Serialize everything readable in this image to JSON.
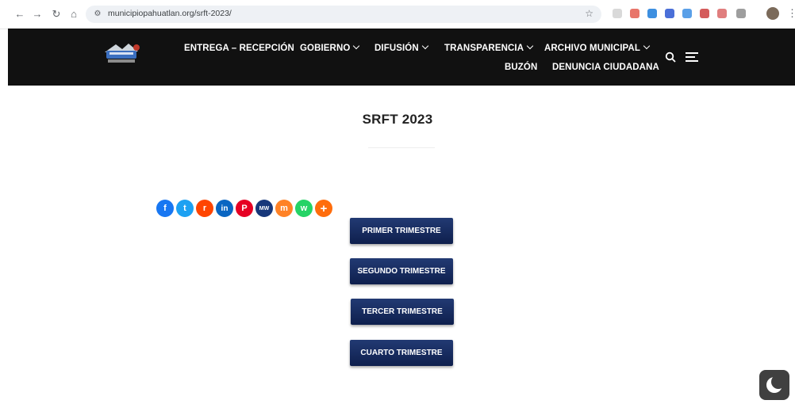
{
  "browser": {
    "url": "municipiopahuatlan.org/srft-2023/",
    "icons": [
      "back-icon",
      "forward-icon",
      "reload-icon",
      "home-icon",
      "site-info-icon",
      "bookmark-star-icon",
      "extensions-icon",
      "profile-avatar",
      "more-menu-icon"
    ]
  },
  "header": {
    "menu": [
      {
        "label": "ENTREGA – RECEPCIÓN",
        "has_submenu": false
      },
      {
        "label": "GOBIERNO",
        "has_submenu": true
      },
      {
        "label": "DIFUSIÓN",
        "has_submenu": true
      },
      {
        "label": "TRANSPARENCIA",
        "has_submenu": true
      },
      {
        "label": "ARCHIVO MUNICIPAL",
        "has_submenu": true
      },
      {
        "label": "BUZÓN",
        "has_submenu": false
      },
      {
        "label": "DENUNCIA CIUDADANA",
        "has_submenu": false
      }
    ]
  },
  "page": {
    "title": "SRFT 2023"
  },
  "share": {
    "icons": [
      {
        "name": "facebook",
        "color": "#1877f2",
        "glyph": "f"
      },
      {
        "name": "twitter",
        "color": "#1da1f2",
        "glyph": "t"
      },
      {
        "name": "reddit",
        "color": "#ff4500",
        "glyph": "r"
      },
      {
        "name": "linkedin",
        "color": "#0a66c2",
        "glyph": "in"
      },
      {
        "name": "pinterest",
        "color": "#e60023",
        "glyph": "P"
      },
      {
        "name": "mewe",
        "color": "#17377a",
        "glyph": "MW"
      },
      {
        "name": "mix",
        "color": "#ff8226",
        "glyph": "m"
      },
      {
        "name": "whatsapp",
        "color": "#25d366",
        "glyph": "w"
      },
      {
        "name": "more",
        "color": "#ff6d0c",
        "glyph": "+"
      }
    ]
  },
  "buttons": [
    {
      "label": "PRIMER TRIMESTRE"
    },
    {
      "label": "SEGUNDO TRIMESTRE"
    },
    {
      "label": "TERCER TRIMESTRE"
    },
    {
      "label": "CUARTO TRIMESTRE"
    }
  ],
  "colors": {
    "header_bg": "#111111",
    "button_bg": "#14285c"
  }
}
